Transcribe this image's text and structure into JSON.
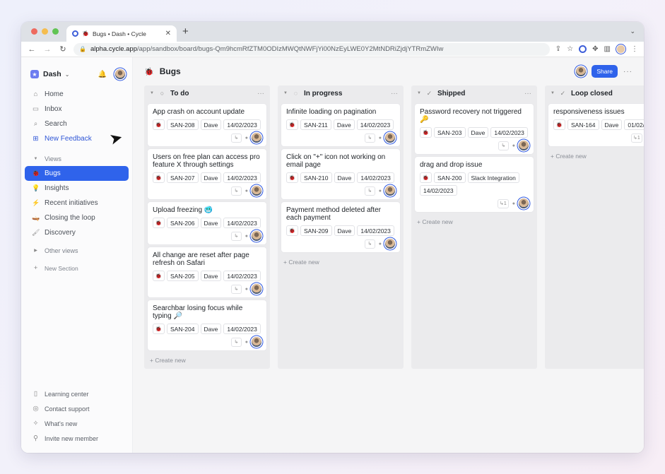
{
  "browser": {
    "tab_title": "Bugs • Dash • Cycle",
    "url_host": "alpha.cycle.app",
    "url_path": "/app/sandbox/board/bugs-Qm9hcmRfZTM0ODIzMWQtNWFjYi00NzEyLWE0Y2MtNDRiZjdjYTRmZWIw",
    "traffic_colors": [
      "#ee6a5f",
      "#f5bd4f",
      "#61c454"
    ]
  },
  "sidebar": {
    "workspace": "Dash",
    "nav": [
      {
        "label": "Home",
        "icon": "home-icon"
      },
      {
        "label": "Inbox",
        "icon": "inbox-icon"
      },
      {
        "label": "Search",
        "icon": "search-icon"
      },
      {
        "label": "New Feedback",
        "icon": "plus-icon"
      }
    ],
    "views_label": "Views",
    "views": [
      {
        "label": "Bugs",
        "icon": "bug-icon"
      },
      {
        "label": "Insights",
        "icon": "lightbulb-icon"
      },
      {
        "label": "Recent initiatives",
        "icon": "lightning-icon"
      },
      {
        "label": "Closing the loop",
        "icon": "loop-icon"
      },
      {
        "label": "Discovery",
        "icon": "brush-icon"
      }
    ],
    "other_views": "Other views",
    "new_section": "New Section",
    "bottom": [
      {
        "label": "Learning center",
        "icon": "book-icon"
      },
      {
        "label": "Contact support",
        "icon": "support-icon"
      },
      {
        "label": "What's new",
        "icon": "sparkle-icon"
      },
      {
        "label": "Invite new member",
        "icon": "user-plus-icon"
      }
    ]
  },
  "board": {
    "title": "Bugs",
    "share": "Share",
    "accent": "#2f63eb",
    "create_new": "+ Create new",
    "columns": [
      {
        "name": "To do",
        "cards": [
          {
            "title": "App crash on account update",
            "props": [
              "SAN-208",
              "Dave",
              "14/02/2023"
            ]
          },
          {
            "title": "Users on free plan can access pro feature X through settings",
            "props": [
              "SAN-207",
              "Dave",
              "14/02/2023"
            ]
          },
          {
            "title": "Upload freezing 🥶",
            "props": [
              "SAN-206",
              "Dave",
              "14/02/2023"
            ]
          },
          {
            "title": "All change are reset after page refresh on Safari",
            "props": [
              "SAN-205",
              "Dave",
              "14/02/2023"
            ]
          },
          {
            "title": "Searchbar losing focus while typing 🔎",
            "props": [
              "SAN-204",
              "Dave",
              "14/02/2023"
            ]
          }
        ]
      },
      {
        "name": "In progress",
        "cards": [
          {
            "title": "Infinite loading on pagination",
            "props": [
              "SAN-211",
              "Dave",
              "14/02/2023"
            ]
          },
          {
            "title": "Click on \"+\" icon not working on email page",
            "props": [
              "SAN-210",
              "Dave",
              "14/02/2023"
            ]
          },
          {
            "title": "Payment method deleted after each payment",
            "props": [
              "SAN-209",
              "Dave",
              "14/02/2023"
            ]
          }
        ]
      },
      {
        "name": "Shipped",
        "cards": [
          {
            "title": "Password recovery not triggered 🔑",
            "props": [
              "SAN-203",
              "Dave",
              "14/02/2023"
            ]
          },
          {
            "title": "drag and drop issue",
            "props": [
              "SAN-200",
              "Slack Integration",
              "14/02/2023"
            ],
            "link_count": "1"
          }
        ]
      },
      {
        "name": "Loop closed",
        "cards": [
          {
            "title": "responsiveness issues",
            "props": [
              "SAN-164",
              "Dave",
              "01/02/2023"
            ],
            "link_count": "1"
          }
        ]
      }
    ]
  }
}
